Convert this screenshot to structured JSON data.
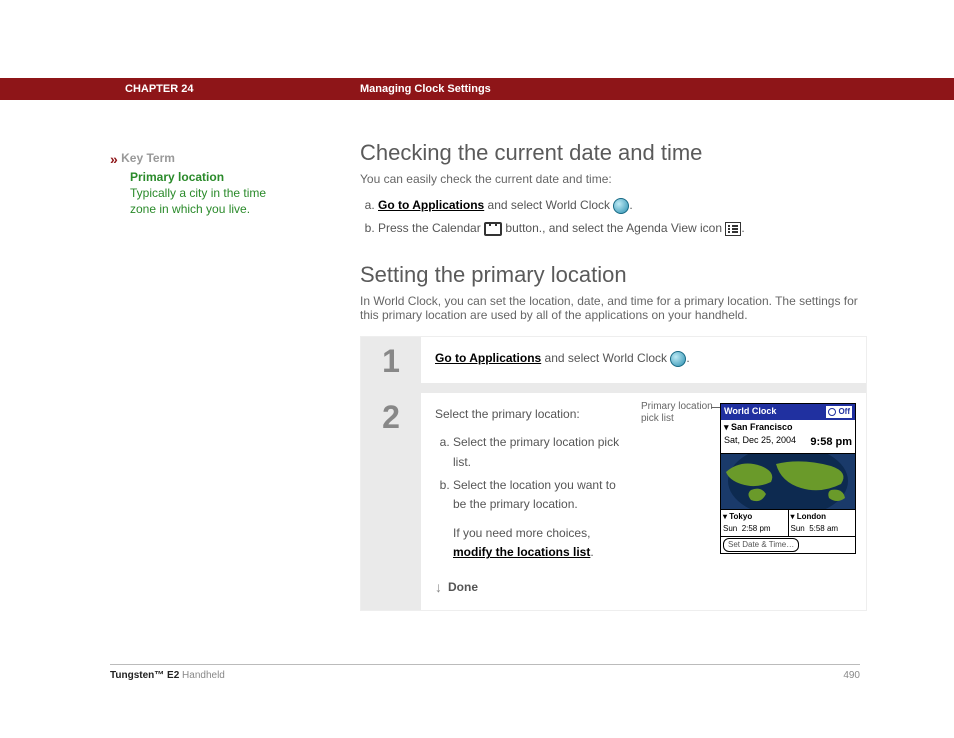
{
  "header": {
    "chapter": "CHAPTER 24",
    "title": "Managing Clock Settings"
  },
  "sidebar": {
    "marker": "»",
    "keyterm_label": "Key Term",
    "primary": "Primary location",
    "definition": "Typically a city in the time zone in which you live."
  },
  "section1": {
    "title": "Checking the current date and time",
    "subtitle": "You can easily check the current date and time:",
    "item_a_link": "Go to Applications",
    "item_a_rest": " and select World Clock ",
    "item_b_before": "Press the Calendar ",
    "item_b_mid": " button., and select the Agenda View icon ",
    "period": "."
  },
  "section2": {
    "title": "Setting the primary location",
    "subtitle": "In World Clock, you can set the location, date, and time for a primary location. The settings for this primary location are used by all of the applications on your handheld."
  },
  "steps": {
    "one": {
      "num": "1",
      "link": "Go to Applications",
      "rest": " and select World Clock ",
      "period": "."
    },
    "two": {
      "num": "2",
      "intro": "Select the primary location:",
      "a": "Select the primary location pick list.",
      "b": "Select the location you want to be the primary location.",
      "more_before": "If you need more choices, ",
      "more_link": "modify the locations list",
      "more_after": ".",
      "done": "Done",
      "callout": "Primary location pick list"
    }
  },
  "device": {
    "title": "World Clock",
    "off": "Off",
    "primary_city": "San Francisco",
    "date": "Sat, Dec 25, 2004",
    "time": "9:58 pm",
    "city2": "Tokyo",
    "city2_day": "Sun",
    "city2_time": "2:58 pm",
    "city3": "London",
    "city3_day": "Sun",
    "city3_time": "5:58 am",
    "set_btn": "Set Date & Time…"
  },
  "footer": {
    "product_bold": "Tungsten™ E2",
    "product_rest": " Handheld",
    "page": "490"
  }
}
